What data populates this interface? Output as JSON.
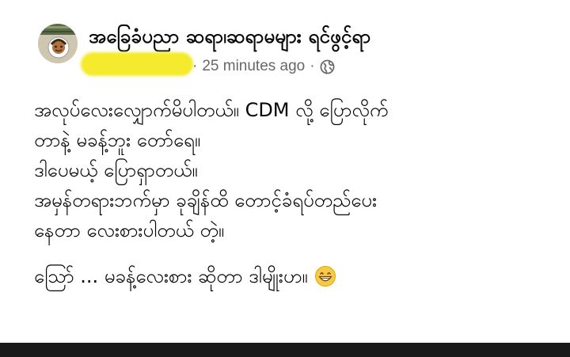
{
  "post": {
    "group_name": "အခြေခံပညာ ဆရာ၊ဆရာမများ ရင်ဖွင့်ရာ",
    "timestamp": "25 minutes ago",
    "privacy_icon": "globe-icon",
    "body_lines": [
      "အလုပ်လေးလျှောက်မိပါတယ်။ CDM လို့ ပြောလိုက်",
      "တာနဲ့ မခန့်ဘူး တော်ရေ။",
      "ဒါပေမယ့် ပြောရှာတယ်။",
      "အမှန်တရားဘက်မှာ ခုချိန်ထိ တောင့်ခံရပ်တည်ပေး",
      "နေတာ လေးစားပါတယ် တဲ့။"
    ],
    "last_line": "သြော် ... မခန့်လေးစား ဆိုတာ ဒါမျိုးဟ။",
    "last_emoji": "grinning-face-icon"
  }
}
